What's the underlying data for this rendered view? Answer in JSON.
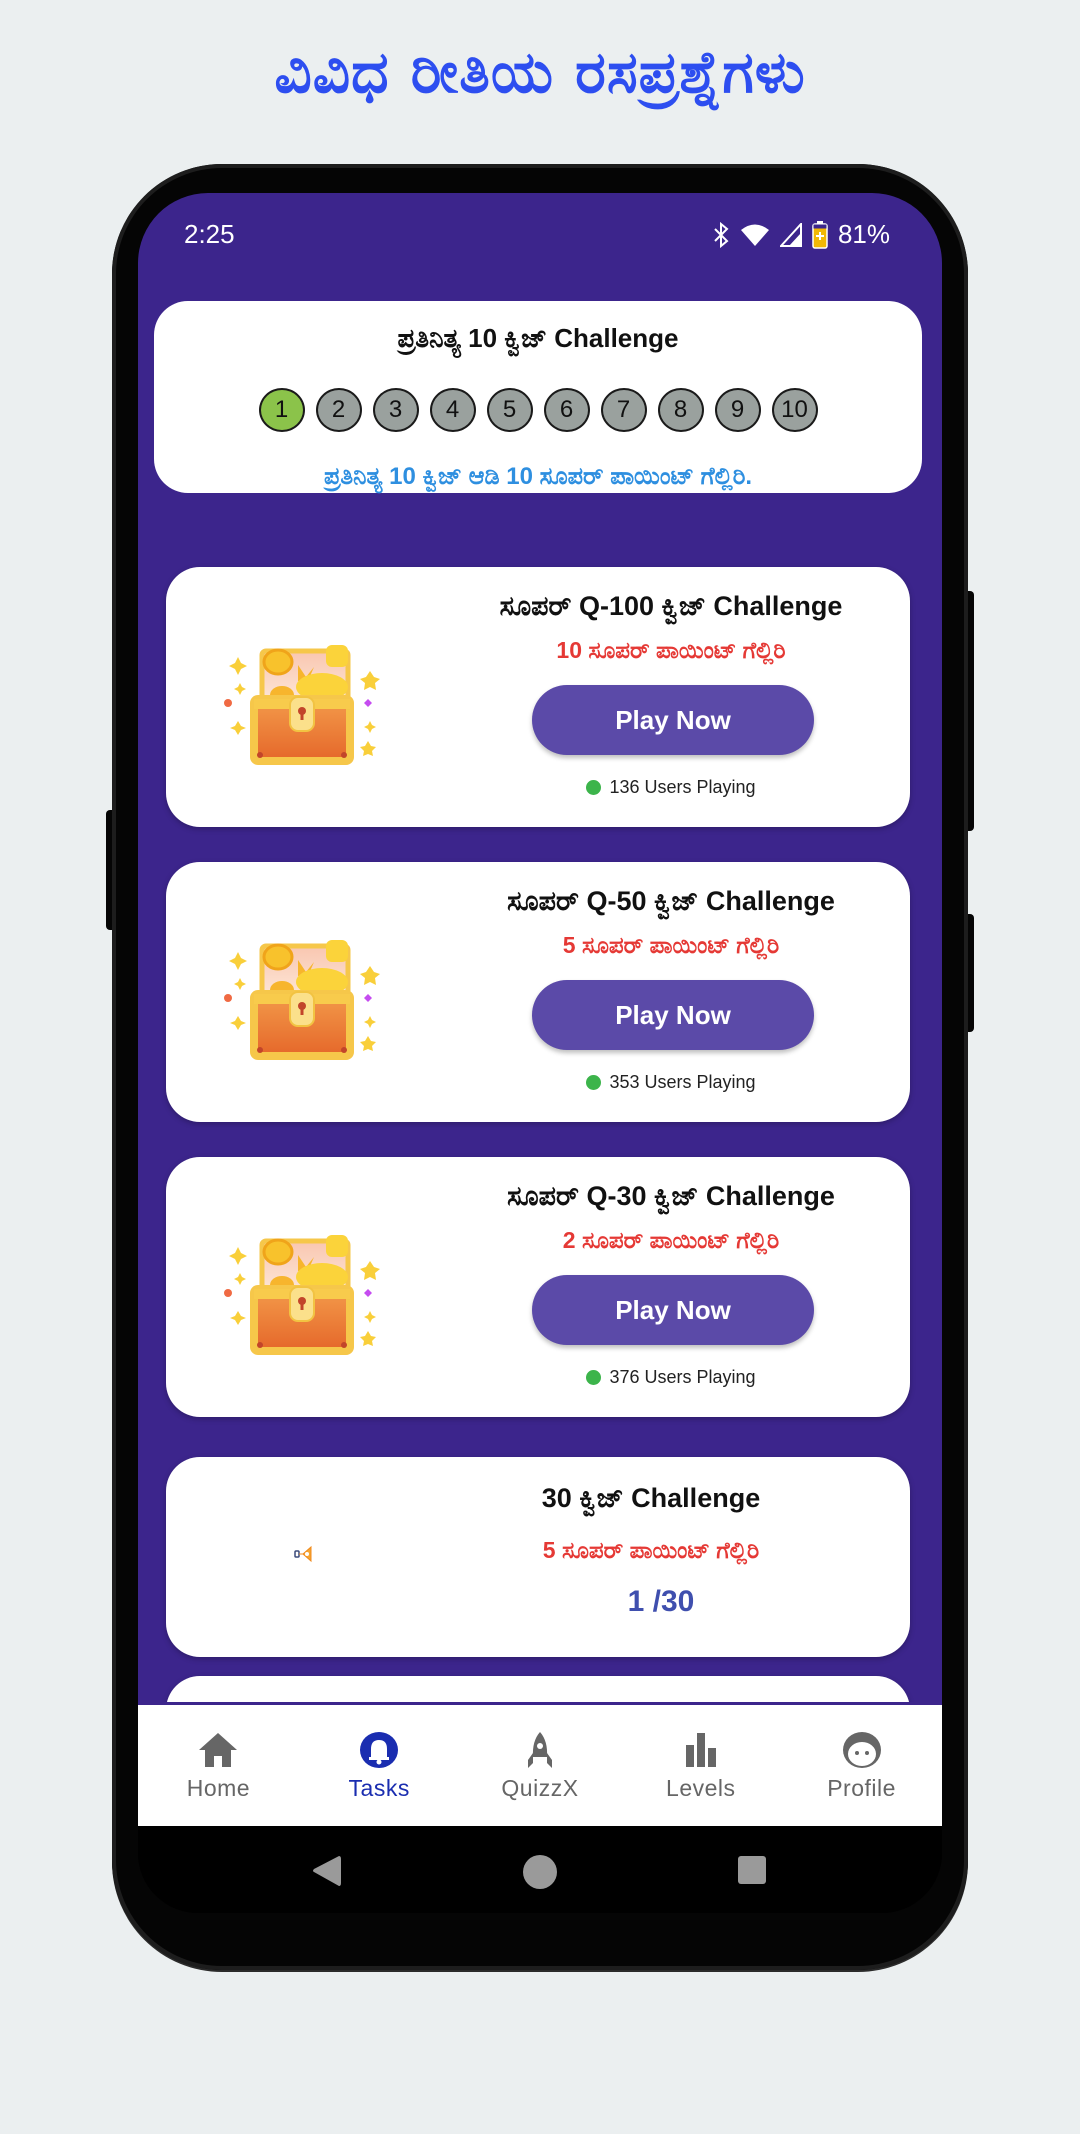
{
  "promo": {
    "title": "ವಿವಿಧ ರೀತಿಯ ರಸಪ್ರಶ್ನೆಗಳು"
  },
  "status_bar": {
    "time": "2:25",
    "battery_percent": "81%",
    "icons": [
      "bluetooth-icon",
      "wifi-icon",
      "signal-icon",
      "battery-charging-icon"
    ]
  },
  "daily": {
    "title": "ಪ್ರತಿನಿತ್ಯ 10 ಕ್ವಿಜ್ Challenge",
    "steps": [
      "1",
      "2",
      "3",
      "4",
      "5",
      "6",
      "7",
      "8",
      "9",
      "10"
    ],
    "completed": 1,
    "subtitle": "ಪ್ರತಿನಿತ್ಯ 10 ಕ್ವಿಜ್ ಆಡಿ 10 ಸೂಪರ್ ಪಾಯಿಂಟ್ ಗೆಲ್ಲಿರಿ."
  },
  "challenges": [
    {
      "title": "ಸೂಪರ್ Q-100 ಕ್ವಿಜ್ Challenge",
      "points": "10 ಸೂಪರ್ ಪಾಯಿಂಟ್ ಗೆಲ್ಲಿರಿ",
      "button": "Play Now",
      "users": "136 Users Playing",
      "icon": "treasure-chest-icon"
    },
    {
      "title": "ಸೂಪರ್ Q-50 ಕ್ವಿಜ್ Challenge",
      "points": "5 ಸೂಪರ್ ಪಾಯಿಂಟ್ ಗೆಲ್ಲಿರಿ",
      "button": "Play Now",
      "users": "353 Users Playing",
      "icon": "treasure-chest-icon"
    },
    {
      "title": "ಸೂಪರ್ Q-30 ಕ್ವಿಜ್ Challenge",
      "points": "2 ಸೂಪರ್ ಪಾಯಿಂಟ್ ಗೆಲ್ಲಿರಿ",
      "button": "Play Now",
      "users": "376 Users Playing",
      "icon": "treasure-chest-icon"
    }
  ],
  "quiz30": {
    "title": "30 ಕ್ವಿಜ್ Challenge",
    "points": "5 ಸೂಪರ್ ಪಾಯಿಂಟ್ ಗೆಲ್ಲಿರಿ",
    "progress": "1 /30",
    "icon": "trophy-icon"
  },
  "bottom_nav": {
    "active": "Tasks",
    "items": [
      {
        "label": "Home",
        "icon": "home-icon"
      },
      {
        "label": "Tasks",
        "icon": "bell-icon"
      },
      {
        "label": "QuizzX",
        "icon": "rocket-icon"
      },
      {
        "label": "Levels",
        "icon": "bar-chart-icon"
      },
      {
        "label": "Profile",
        "icon": "face-icon"
      }
    ]
  },
  "colors": {
    "brand_purple": "#3c258c",
    "button_purple": "#5b4aa8",
    "points_red": "#e53935",
    "daily_blue": "#2e8fe0",
    "active_nav": "#1a2db0",
    "step_done": "#8bc34a",
    "step_pending": "#9aa19e",
    "online_green": "#3cb44b"
  }
}
